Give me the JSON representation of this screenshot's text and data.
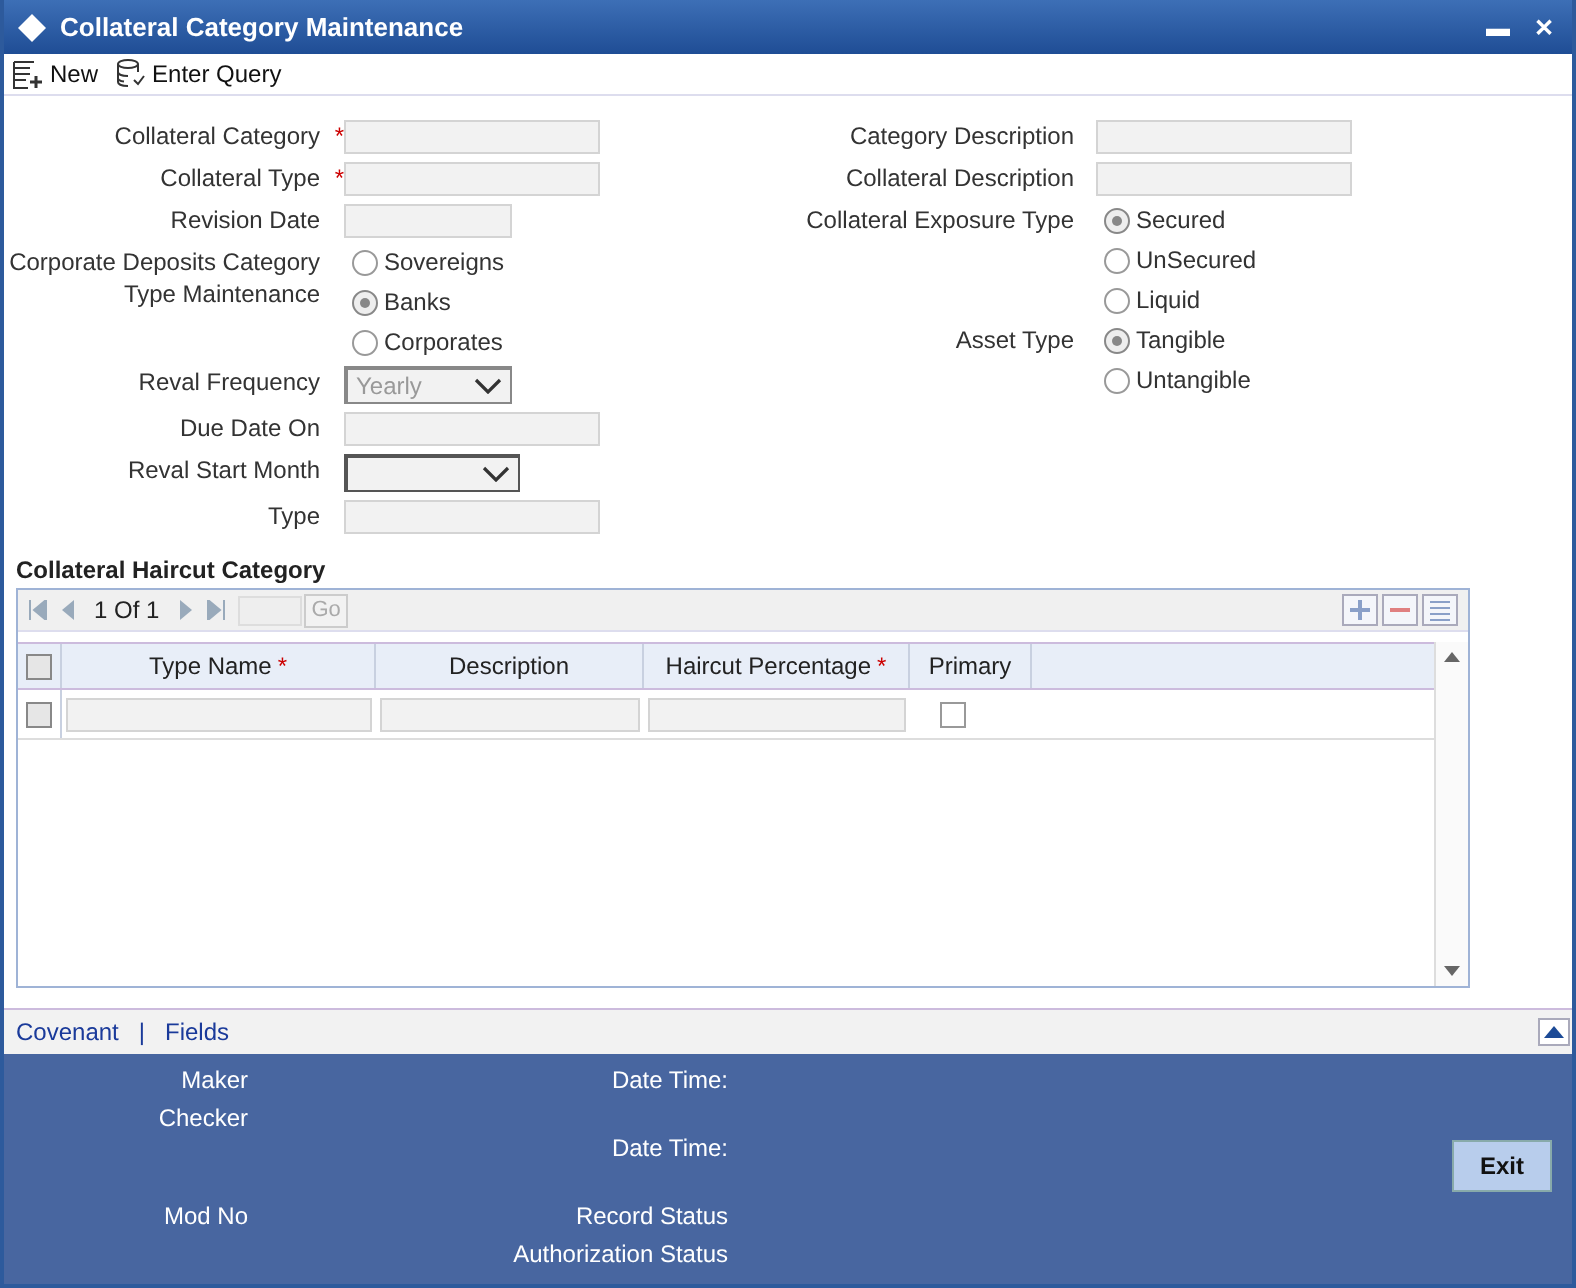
{
  "window": {
    "title": "Collateral Category Maintenance",
    "controls": [
      "▬",
      "✕"
    ]
  },
  "toolbar": [
    {
      "kind": "new",
      "label": "New"
    },
    {
      "kind": "query",
      "label": "Enter Query"
    }
  ],
  "left_fields": [
    {
      "kind": "text",
      "label": "Collateral Category",
      "required": true
    },
    {
      "kind": "text",
      "label": "Collateral Type",
      "required": true
    },
    {
      "kind": "text",
      "label": "Revision Date",
      "required": false
    },
    {
      "kind": "radio",
      "label": "Corporate Deposits Category Type Maintenance",
      "required": false,
      "options": [
        {
          "label": "Sovereigns",
          "selected": false
        },
        {
          "label": "Banks",
          "selected": true
        },
        {
          "label": "Corporates",
          "selected": false
        }
      ]
    },
    {
      "kind": "select",
      "label": "Reval Frequency",
      "required": false,
      "value": "Yearly",
      "disabled": true
    },
    {
      "kind": "text",
      "label": "Due Date On",
      "required": false
    },
    {
      "kind": "select",
      "label": "Reval Start Month",
      "required": false,
      "disabled": false
    },
    {
      "kind": "text",
      "label": "Type",
      "required": false
    }
  ],
  "right_fields": [
    {
      "kind": "text",
      "label": "Category Description",
      "required": false
    },
    {
      "kind": "text",
      "label": "Collateral Description",
      "required": false
    },
    {
      "kind": "radio",
      "label": "Collateral Exposure Type",
      "required": false,
      "options": [
        {
          "label": "Secured",
          "selected": true
        },
        {
          "label": "UnSecured",
          "selected": false
        },
        {
          "label": "Liquid",
          "selected": false
        }
      ]
    },
    {
      "kind": "radio",
      "label": "Asset Type",
      "required": false,
      "options": [
        {
          "label": "Tangible",
          "selected": true
        },
        {
          "label": "Untangible",
          "selected": false
        }
      ]
    }
  ],
  "grid": {
    "title": "Collateral Haircut Category",
    "pager": "1 Of 1",
    "go": "Go",
    "columns": [
      {
        "label": "Type Name",
        "required": true
      },
      {
        "label": "Description",
        "required": false
      },
      {
        "label": "Haircut Percentage",
        "required": true
      },
      {
        "label": "Primary",
        "required": false
      }
    ],
    "all_checked": false,
    "rows": [
      {
        "checked": false,
        "primary": false
      }
    ]
  },
  "required_mark": "*",
  "links": [
    "Covenant",
    "Fields"
  ],
  "link_separator": "|",
  "audit": {
    "left": [
      "Maker",
      "Checker",
      "Mod No"
    ],
    "right": [
      "Date Time:",
      "Date Time:",
      "Record Status",
      "Authorization Status"
    ]
  },
  "exit_button": "Exit"
}
